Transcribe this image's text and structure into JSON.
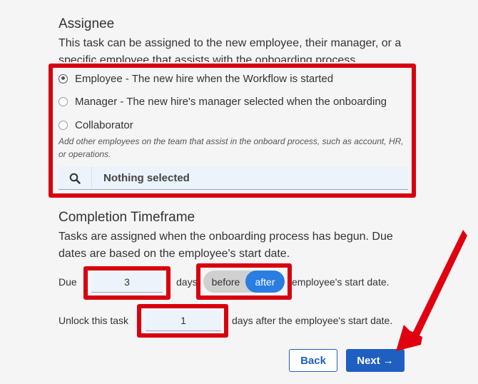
{
  "assignee": {
    "title": "Assignee",
    "description": "This task can be assigned to the new employee, their manager, or a specific employee that assists with the onboarding process.",
    "options": [
      {
        "label": "Employee - The new hire when the Workflow is started",
        "checked": true
      },
      {
        "label": "Manager - The new hire's manager selected when the onboarding",
        "checked": false
      },
      {
        "label": "Collaborator",
        "checked": false
      }
    ],
    "collaborator_hint": "Add other employees on the team that assist in the onboard process, such as account, HR, or operations.",
    "collaborator_selected": "Nothing selected"
  },
  "completion": {
    "title": "Completion Timeframe",
    "description": "Tasks are assigned when the onboarding process has begun. Due dates are based on the employee's start date.",
    "due_label": "Due",
    "due_value": "3",
    "days_label": "days",
    "before_label": "before",
    "after_label": "after",
    "due_suffix": "employee's start date.",
    "unlock_label": "Unlock this task",
    "unlock_value": "1",
    "unlock_suffix": "days after the employee's start date."
  },
  "buttons": {
    "back": "Back",
    "next": "Next",
    "next_arrow": "→"
  },
  "colors": {
    "highlight": "#d7000f",
    "primary": "#1f5fbf",
    "toggle_active": "#2a7de1"
  }
}
